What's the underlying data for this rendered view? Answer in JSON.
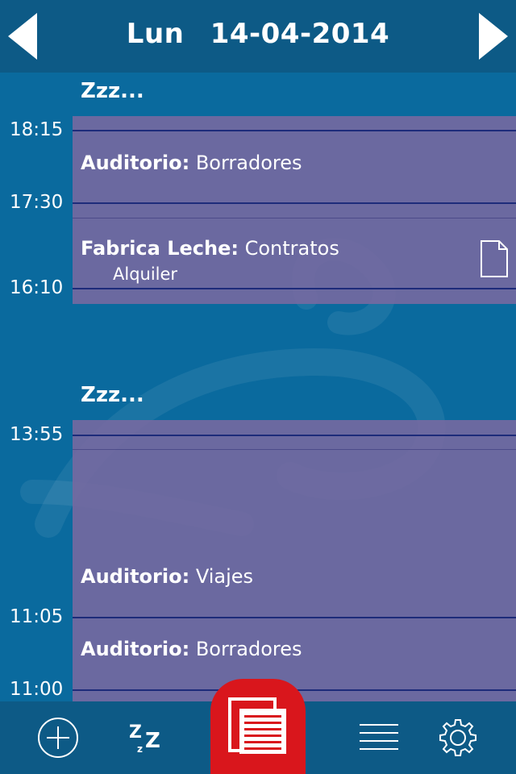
{
  "header": {
    "day": "Lun",
    "date": "14-04-2014",
    "prev_icon": "chevron-left-icon",
    "next_icon": "chevron-right-icon"
  },
  "sleep_labels": [
    "Zzz...",
    "Zzz..."
  ],
  "events": [
    {
      "place": "Auditorio:",
      "task": "Borradores",
      "note": ""
    },
    {
      "place": "Fabrica Leche:",
      "task": "Contratos",
      "note": "Alquiler",
      "icon": "document-icon"
    },
    {
      "place": "Auditorio:",
      "task": "Viajes",
      "note": ""
    },
    {
      "place": "Auditorio:",
      "task": "Borradores",
      "note": ""
    }
  ],
  "times": [
    "18:15",
    "17:30",
    "16:10",
    "13:55",
    "11:05",
    "11:00"
  ],
  "tabbar": {
    "items": [
      {
        "name": "add",
        "icon": "plus-circle-icon"
      },
      {
        "name": "sleep",
        "icon": "sleep-zz-icon",
        "label": "z z Z"
      },
      {
        "name": "log",
        "icon": "document-list-icon",
        "active": true
      },
      {
        "name": "list",
        "icon": "list-lines-icon"
      },
      {
        "name": "settings",
        "icon": "gear-icon"
      }
    ]
  },
  "colors": {
    "background": "#0a6a9e",
    "header": "#0d5a86",
    "event_block": "#7369a0",
    "active_tab": "#d9161c",
    "hour_line": "#1d2b7a"
  }
}
